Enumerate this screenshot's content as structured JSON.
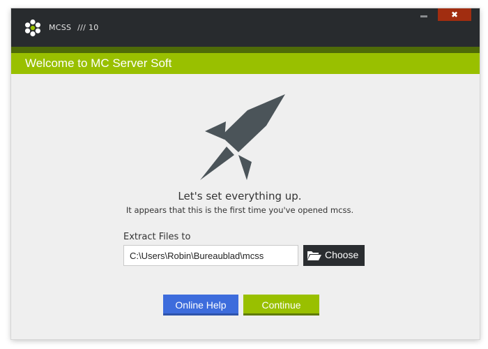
{
  "window": {
    "app_name": "MCSS",
    "app_version_separator": "///",
    "app_version": "10",
    "close_label": "✖"
  },
  "header": {
    "title": "Welcome to MC Server Soft"
  },
  "main": {
    "headline": "Let's set everything up.",
    "subline": "It appears that this is the first time you've opened mcss.",
    "extract_label": "Extract Files to",
    "extract_path_value": "C:\\Users\\Robin\\Bureaublad\\mcss",
    "choose_label": "Choose"
  },
  "footer": {
    "online_help_label": "Online Help",
    "continue_label": "Continue"
  },
  "colors": {
    "accent_green": "#99c000",
    "titlebar_dark": "#282b2e",
    "close_red": "#a12d10",
    "help_blue": "#3d6cdc",
    "icon_slate": "#4b5459"
  },
  "icons": {
    "logo": "hexagon-flower-logo-icon",
    "hero": "rocket-icon",
    "choose": "folder-open-icon",
    "minimize": "minimize-icon"
  }
}
